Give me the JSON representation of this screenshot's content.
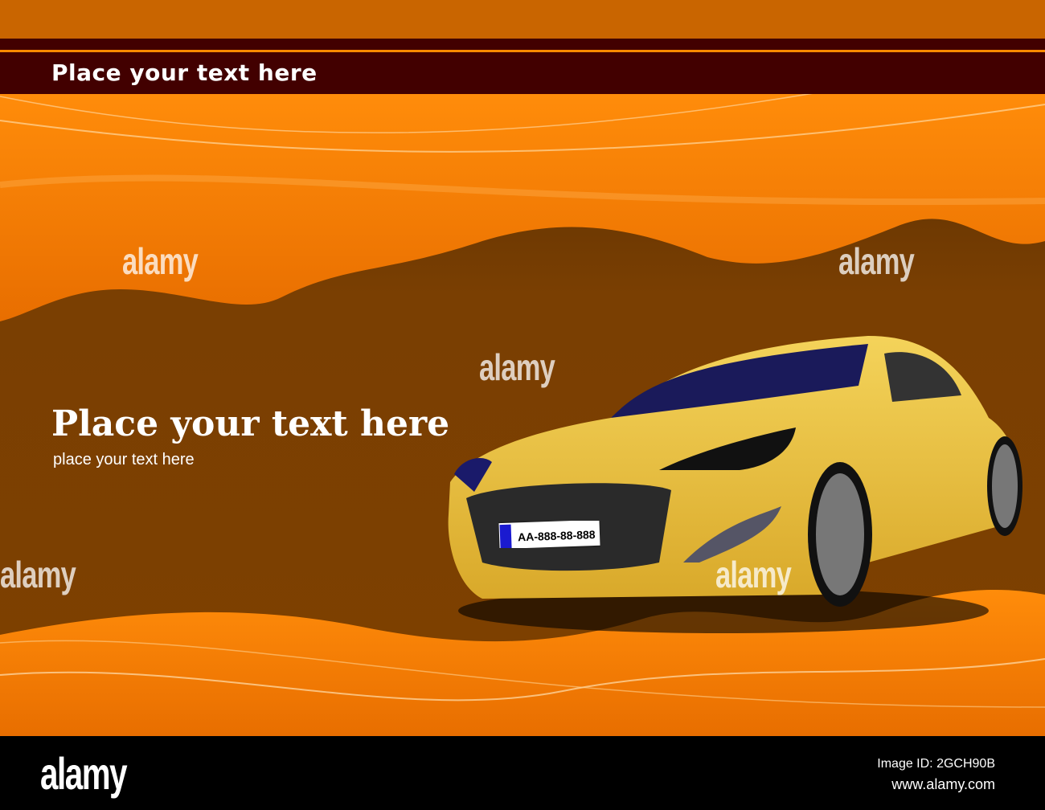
{
  "banner": {
    "title": "Place your text here"
  },
  "main": {
    "headline": "Place your text here",
    "subline": "place your text here"
  },
  "car": {
    "plate": "AA-888-88-888",
    "color": "#e8c23a"
  },
  "watermarks": [
    "alamy",
    "alamy",
    "alamy",
    "alamy",
    "alamy"
  ],
  "footer": {
    "logo": "alamy",
    "image_id": "Image ID: 2GCH90B",
    "url": "www.alamy.com"
  },
  "colors": {
    "orange": "#ff8a00",
    "brown": "#7a3e00",
    "banner": "#420000"
  }
}
